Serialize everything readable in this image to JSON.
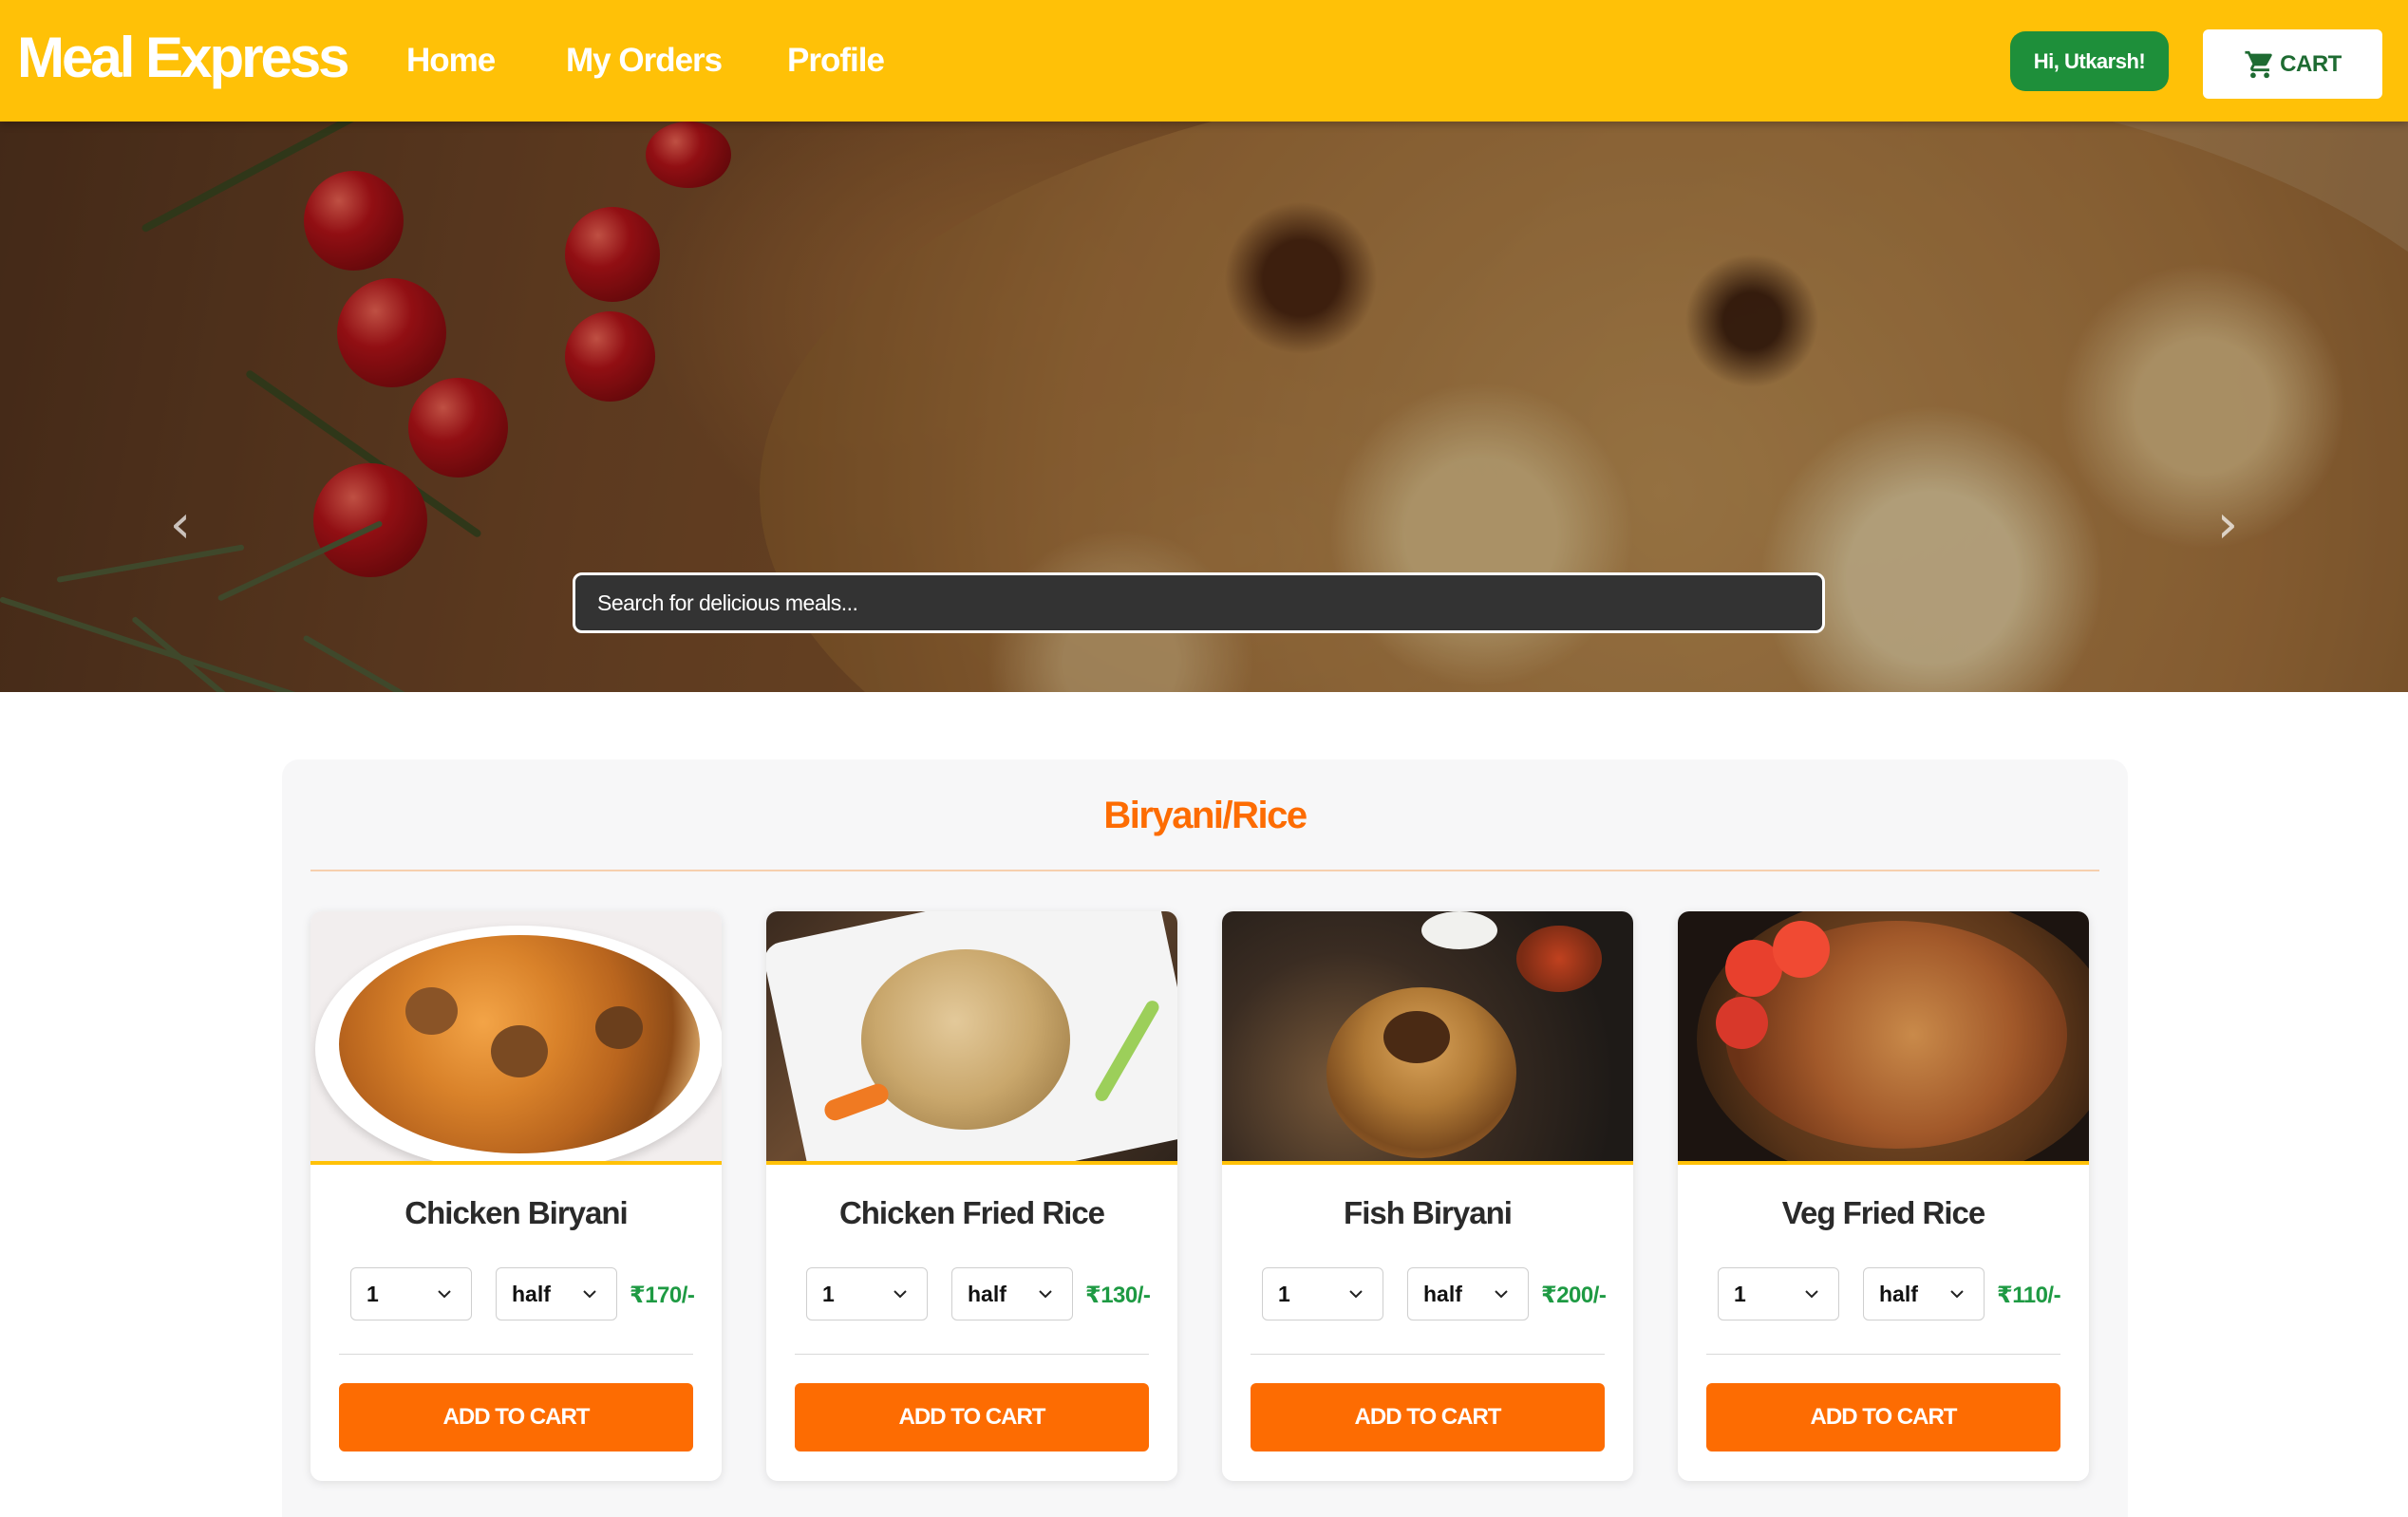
{
  "navbar": {
    "brand": "Meal Express",
    "links": [
      "Home",
      "My Orders",
      "Profile"
    ],
    "greeting": "Hi, Utkarsh!",
    "cart_label": "CART",
    "bg_color": "#ffc107"
  },
  "hero": {
    "search_placeholder": "Search for delicious meals...",
    "prev_icon": "chevron-left-icon",
    "next_icon": "chevron-right-icon"
  },
  "category": {
    "title": "Biryani/Rice",
    "accent_color": "#fd6c02",
    "items": [
      {
        "name": "Chicken Biryani",
        "qty": "1",
        "size": "half",
        "price": "₹170/-",
        "button": "ADD TO CART"
      },
      {
        "name": "Chicken Fried Rice",
        "qty": "1",
        "size": "half",
        "price": "₹130/-",
        "button": "ADD TO CART"
      },
      {
        "name": "Fish Biryani",
        "qty": "1",
        "size": "half",
        "price": "₹200/-",
        "button": "ADD TO CART"
      },
      {
        "name": "Veg Fried Rice",
        "qty": "1",
        "size": "half",
        "price": "₹110/-",
        "button": "ADD TO CART"
      }
    ]
  },
  "colors": {
    "greeting_bg": "#1e8f3a",
    "price": "#1e9a43",
    "button": "#fd6c02"
  }
}
